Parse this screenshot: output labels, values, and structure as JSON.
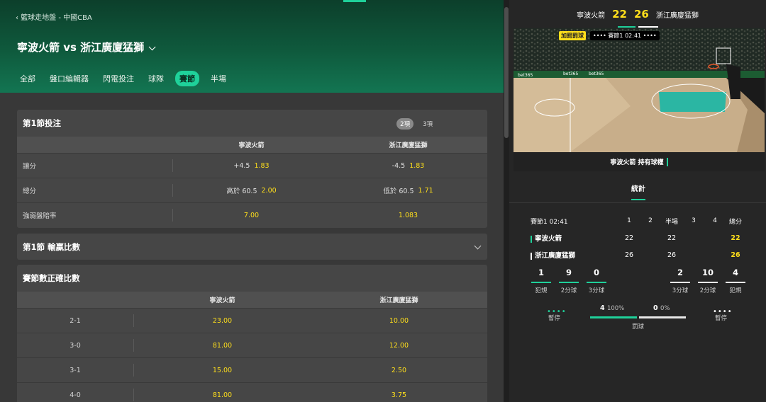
{
  "header": {
    "breadcrumb": "籃球走地盤 - 中國CBA",
    "title": "寧波火箭 vs 浙江廣廈猛獅",
    "tabs": [
      "全部",
      "盤口編輯器",
      "閃電投注",
      "球隊",
      "賽節",
      "半場"
    ],
    "active_tab": "賽節"
  },
  "panel1": {
    "title": "第1節投注",
    "pills": [
      "2項",
      "3項"
    ],
    "home": "寧波火箭",
    "away": "浙江廣廈猛獅",
    "rows": [
      {
        "label": "讓分",
        "home_line": "+4.5",
        "home_odds": "1.83",
        "away_line": "-4.5",
        "away_odds": "1.83"
      },
      {
        "label": "總分",
        "home_line": "高於 60.5",
        "home_odds": "2.00",
        "away_line": "低於 60.5",
        "away_odds": "1.71"
      },
      {
        "label": "強弱盤賠率",
        "home_line": "",
        "home_odds": "7.00",
        "away_line": "",
        "away_odds": "1.083"
      }
    ]
  },
  "panel2": {
    "title": "第1節 輸贏比數"
  },
  "panel3": {
    "title": "賽節數正確比數",
    "home": "寧波火箭",
    "away": "浙江廣廈猛獅",
    "rows": [
      {
        "label": "2-1",
        "home": "23.00",
        "away": "10.00"
      },
      {
        "label": "3-0",
        "home": "81.00",
        "away": "12.00"
      },
      {
        "label": "3-1",
        "home": "15.00",
        "away": "2.50"
      },
      {
        "label": "4-0",
        "home": "81.00",
        "away": "3.75"
      }
    ]
  },
  "match": {
    "home": "寧波火箭",
    "away": "浙江廣廈猛獅",
    "home_score": "22",
    "away_score": "26",
    "court_badge": "加罰罰球",
    "period": "賽節1",
    "clock": "02:41",
    "possession": "寧波火箭 持有球權",
    "ad_text": "bet365"
  },
  "stats": {
    "tab": "統計",
    "header": {
      "label": "賽節1",
      "clock": "02:41",
      "cols": [
        "1",
        "2",
        "半場",
        "3",
        "4",
        "總分"
      ]
    },
    "teams": [
      {
        "name": "寧波火箭",
        "q1": "22",
        "half": "22",
        "total": "22",
        "color": "#1fd19a"
      },
      {
        "name": "浙江廣廈猛獅",
        "q1": "26",
        "half": "26",
        "total": "26",
        "color": "#ffffff"
      }
    ],
    "home_boxes": [
      {
        "v": "1",
        "k": "犯規"
      },
      {
        "v": "9",
        "k": "2分球"
      },
      {
        "v": "0",
        "k": "3分球"
      }
    ],
    "away_boxes": [
      {
        "v": "2",
        "k": "3分球"
      },
      {
        "v": "10",
        "k": "2分球"
      },
      {
        "v": "4",
        "k": "犯規"
      }
    ],
    "timeout_label": "暫停",
    "fb_home": "4",
    "fb_home_pct": "100%",
    "fb_away": "0",
    "fb_away_pct": "0%",
    "fb_label": "罰球"
  },
  "colors": {
    "accent": "#1fd19a",
    "odds": "#ffdf1b"
  }
}
